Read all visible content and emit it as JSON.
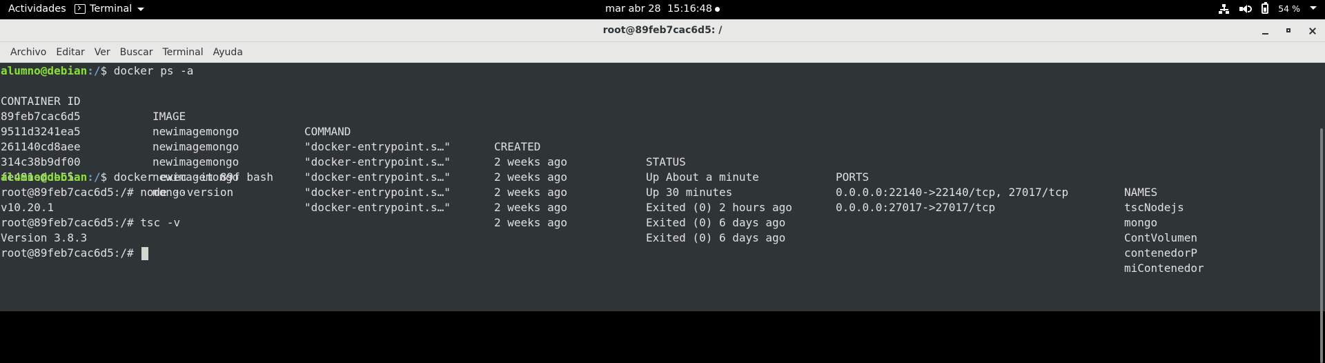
{
  "topbar": {
    "activities": "Actividades",
    "app_menu": "Terminal",
    "clock": "mar abr 28  15:16:48",
    "battery": "54 %"
  },
  "window": {
    "title": "root@89feb7cac6d5: /"
  },
  "menubar": {
    "items": [
      "Archivo",
      "Editar",
      "Ver",
      "Buscar",
      "Terminal",
      "Ayuda"
    ]
  },
  "terminal": {
    "prompt_user": "alumno@debian",
    "prompt_path": ":/",
    "prompt_end": "$ ",
    "cmd1": "docker ps -a",
    "headers": {
      "container_id": "CONTAINER ID",
      "image": "IMAGE",
      "command": "COMMAND",
      "created": "CREATED",
      "status": "STATUS",
      "ports": "PORTS",
      "names": "NAMES"
    },
    "rows": [
      {
        "id": "89feb7cac6d5",
        "image": "newimagemongo",
        "command": "\"docker-entrypoint.s…\"",
        "created": "2 weeks ago",
        "status": "Up About a minute",
        "ports": "0.0.0.0:22140->22140/tcp, 27017/tcp",
        "name": "tscNodejs"
      },
      {
        "id": "9511d3241ea5",
        "image": "newimagemongo",
        "command": "\"docker-entrypoint.s…\"",
        "created": "2 weeks ago",
        "status": "Up 30 minutes",
        "ports": "0.0.0.0:27017->27017/tcp",
        "name": "mongo"
      },
      {
        "id": "261140cd8aee",
        "image": "newimagemongo",
        "command": "\"docker-entrypoint.s…\"",
        "created": "2 weeks ago",
        "status": "Exited (0) 2 hours ago",
        "ports": "",
        "name": "ContVolumen"
      },
      {
        "id": "314c38b9df00",
        "image": "newimagemongo",
        "command": "\"docker-entrypoint.s…\"",
        "created": "2 weeks ago",
        "status": "Exited (0) 6 days ago",
        "ports": "",
        "name": "contenedorP"
      },
      {
        "id": "fe481eddb65a",
        "image": "mongo",
        "command": "\"docker-entrypoint.s…\"",
        "created": "2 weeks ago",
        "status": "Exited (0) 6 days ago",
        "ports": "",
        "name": "miContenedor"
      }
    ],
    "cmd2": "docker exec -it 89f bash",
    "lines": [
      "root@89feb7cac6d5:/# node --version",
      "v10.20.1",
      "root@89feb7cac6d5:/# tsc -v",
      "Version 3.8.3",
      "root@89feb7cac6d5:/# "
    ]
  },
  "colors": {
    "terminal_bg": "#2f3436",
    "prompt_user": "#8ae234",
    "prompt_path": "#729fcf"
  }
}
